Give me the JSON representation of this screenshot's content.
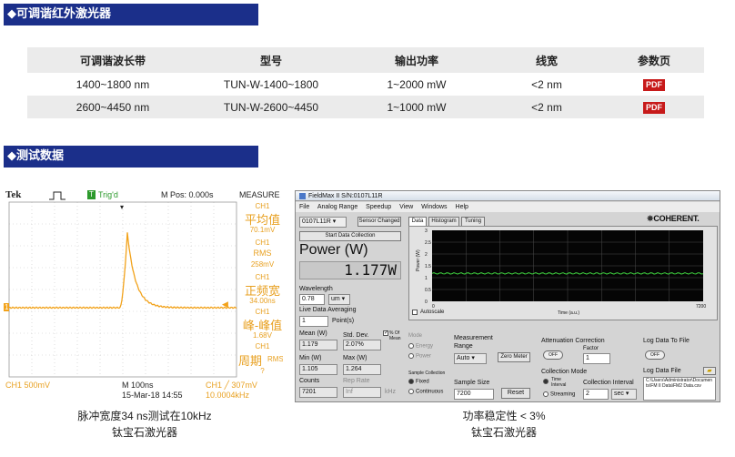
{
  "section1": {
    "title": "◆可调谐红外激光器"
  },
  "table": {
    "headers": [
      "可调谐波长带",
      "型号",
      "输出功率",
      "线宽",
      "参数页"
    ],
    "rows": [
      {
        "band": "1400~1800 nm",
        "model": "TUN-W-1400~1800",
        "power": "1~2000 mW",
        "linewidth": "<2 nm",
        "doc": "PDF"
      },
      {
        "band": "2600~4450 nm",
        "model": "TUN-W-2600~4450",
        "power": "1~1000 mW",
        "linewidth": "<2 nm",
        "doc": "PDF"
      }
    ]
  },
  "section2": {
    "title": "◆测试数据"
  },
  "scope": {
    "brand": "Tek",
    "trig_status": "Trig'd",
    "trig_badge": "T",
    "mpos": "M Pos: 0.000s",
    "measure": "MEASURE",
    "ch1_marker": "1",
    "measurements": [
      {
        "ch": "CH1",
        "name": "平均值",
        "value": "70.1mV"
      },
      {
        "ch": "CH1",
        "name": "RMS",
        "value": "258mV"
      },
      {
        "ch": "CH1",
        "name": "正频宽",
        "value": "34.00ns"
      },
      {
        "ch": "CH1",
        "name": "峰-峰值",
        "value": "1.68V"
      },
      {
        "ch": "CH1",
        "name": "周期",
        "value": "?",
        "extra": "RMS"
      }
    ],
    "ch1_scale": "CH1  500mV",
    "timebase": "M 100ns",
    "date": "15-Mar-18 14:55",
    "trig_level": "CH1 ╱ 307mV",
    "freq": "10.0004kHz",
    "colors": {
      "trace": "#f2a21a",
      "grid": "#c8c8c8"
    }
  },
  "scope_caption": {
    "line1": "脉冲宽度34 ns测试在10kHz",
    "line2": "钛宝石激光器"
  },
  "fieldmax": {
    "window_title": "FieldMax II S/N:0107L11R",
    "menu": [
      "File",
      "Analog Range",
      "Speedup",
      "View",
      "Windows",
      "Help"
    ],
    "device_select": "0107L11R",
    "sensor_changed": "Sensor Changed",
    "start_btn": "Start Data Collection",
    "power_label": "Power (W)",
    "power_value": "1.177W",
    "wavelength_label": "Wavelength",
    "wavelength_value": "0.78",
    "wavelength_unit": "um",
    "lda_label": "Live Data Averaging",
    "lda_value": "1",
    "lda_unit": "Point(s)",
    "mean_label": "Mean (W)",
    "mean_value": "1.179",
    "std_label": "Std. Dev.",
    "std_value": "2.07%",
    "pct_mean_label": "% Of Mean",
    "min_label": "Min (W)",
    "min_value": "1.105",
    "max_label": "Max (W)",
    "max_value": "1.264",
    "counts_label": "Counts",
    "counts_value": "7201",
    "reprate_label": "Rep Rate",
    "reprate_value": "Inf",
    "reprate_unit": "kHz",
    "tabs": [
      "Data",
      "Histogram",
      "Tuning"
    ],
    "brand": "COHERENT.",
    "plot": {
      "ylabel": "Power (W)",
      "xlabel": "Time (a.u.)",
      "yticks": [
        "3",
        "2.5",
        "2",
        "1.5",
        "1",
        "0.5",
        "0"
      ],
      "xtick_start": "0",
      "xtick_end": "7200",
      "autoscale": "Autoscale",
      "line_color": "#3fd13f"
    },
    "mode_label": "Mode",
    "mode_opts": [
      "Energy",
      "Power"
    ],
    "mr_label": "Measurement Range",
    "mr_value": "Auto",
    "zero_btn": "Zero Meter",
    "att_label": "Attenuation Correction",
    "att_factor_label": "Factor",
    "att_factor": "1",
    "att_toggle": "OFF",
    "log_label": "Log Data To File",
    "log_toggle": "OFF",
    "sc_label": "Sample Collection",
    "sc_opts": [
      "Fixed",
      "Continuous"
    ],
    "ss_label": "Sample Size",
    "ss_value": "7200",
    "reset_btn": "Reset",
    "cm_label": "Collection Mode",
    "cm_opts": [
      "Time Interval",
      "Streaming"
    ],
    "ci_label": "Collection Interval",
    "ci_value": "2",
    "ci_unit": "sec",
    "lf_label": "Log Data File",
    "lf_path": "C:\\Users\\Administrator\\Documents\\FM II Data\\FM2 Data.csv"
  },
  "fm_caption": {
    "line1": "功率稳定性 < 3%",
    "line2": "钛宝石激光器"
  }
}
